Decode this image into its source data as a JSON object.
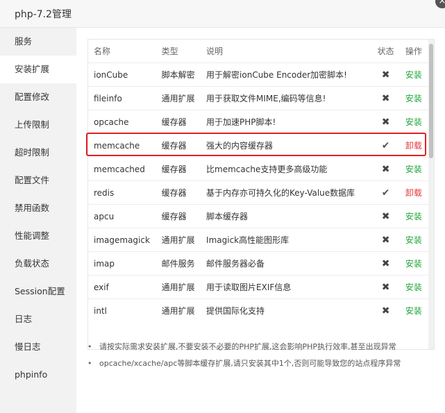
{
  "window": {
    "title": "php-7.2管理",
    "close_icon": "×"
  },
  "sidebar": {
    "items": [
      {
        "label": "服务"
      },
      {
        "label": "安装扩展",
        "active": true
      },
      {
        "label": "配置修改"
      },
      {
        "label": "上传限制"
      },
      {
        "label": "超时限制"
      },
      {
        "label": "配置文件"
      },
      {
        "label": "禁用函数"
      },
      {
        "label": "性能调整"
      },
      {
        "label": "负载状态"
      },
      {
        "label": "Session配置"
      },
      {
        "label": "日志"
      },
      {
        "label": "慢日志"
      },
      {
        "label": "phpinfo"
      }
    ]
  },
  "table": {
    "headers": {
      "name": "名称",
      "type": "类型",
      "desc": "说明",
      "status": "状态",
      "op": "操作"
    },
    "rows": [
      {
        "name": "ionCube",
        "type": "脚本解密",
        "desc": "用于解密ionCube Encoder加密脚本!",
        "status": "✖",
        "op": "安装"
      },
      {
        "name": "fileinfo",
        "type": "通用扩展",
        "desc": "用于获取文件MIME,编码等信息!",
        "status": "✖",
        "op": "安装"
      },
      {
        "name": "opcache",
        "type": "缓存器",
        "desc": "用于加速PHP脚本!",
        "status": "✖",
        "op": "安装"
      },
      {
        "name": "memcache",
        "type": "缓存器",
        "desc": "强大的内容缓存器",
        "status": "✔",
        "op": "卸载"
      },
      {
        "name": "memcached",
        "type": "缓存器",
        "desc": "比memcache支持更多高级功能",
        "status": "✖",
        "op": "安装"
      },
      {
        "name": "redis",
        "type": "缓存器",
        "desc": "基于内存亦可持久化的Key-Value数据库",
        "status": "✔",
        "op": "卸载"
      },
      {
        "name": "apcu",
        "type": "缓存器",
        "desc": "脚本缓存器",
        "status": "✖",
        "op": "安装"
      },
      {
        "name": "imagemagick",
        "type": "通用扩展",
        "desc": "Imagick高性能图形库",
        "status": "✖",
        "op": "安装"
      },
      {
        "name": "imap",
        "type": "邮件服务",
        "desc": "邮件服务器必备",
        "status": "✖",
        "op": "安装"
      },
      {
        "name": "exif",
        "type": "通用扩展",
        "desc": "用于读取图片EXIF信息",
        "status": "✖",
        "op": "安装"
      },
      {
        "name": "intl",
        "type": "通用扩展",
        "desc": "提供国际化支持",
        "status": "✖",
        "op": "安装"
      }
    ]
  },
  "tips": {
    "bullet": "•",
    "items": [
      "请按实际需求安装扩展,不要安装不必要的PHP扩展,这会影响PHP执行效率,甚至出现异常",
      "opcache/xcache/apc等脚本缓存扩展,请只安装其中1个,否则可能导致您的站点程序异常"
    ]
  }
}
